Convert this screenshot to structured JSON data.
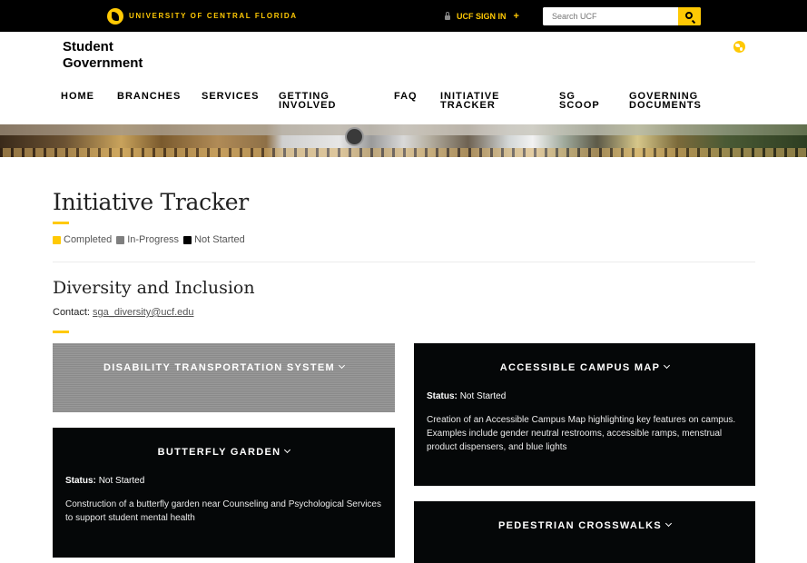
{
  "topbar": {
    "university_name": "UNIVERSITY OF CENTRAL FLORIDA",
    "sign_in_label": "UCF SIGN IN",
    "sign_in_plus": "+",
    "search_placeholder": "Search UCF"
  },
  "header": {
    "site_title_line1": "Student",
    "site_title_line2": "Government"
  },
  "nav": [
    {
      "label": "HOME"
    },
    {
      "label": "BRANCHES"
    },
    {
      "label": "SERVICES"
    },
    {
      "label": "GETTING INVOLVED"
    },
    {
      "label": "FAQ"
    },
    {
      "label": "INITIATIVE TRACKER"
    },
    {
      "label": "SG SCOOP"
    },
    {
      "label": "GOVERNING DOCUMENTS"
    }
  ],
  "page": {
    "title": "Initiative Tracker",
    "legend": [
      {
        "label": "Completed",
        "color": "#ffc904"
      },
      {
        "label": "In-Progress",
        "color": "#7f7f7f"
      },
      {
        "label": "Not Started",
        "color": "#000000"
      }
    ]
  },
  "section": {
    "title": "Diversity and Inclusion",
    "contact_label": "Contact:",
    "contact_email": "sga_diversity@ucf.edu"
  },
  "cards": [
    {
      "title": "DISABILITY TRANSPORTATION SYSTEM",
      "state": "In-Progress"
    },
    {
      "title": "ACCESSIBLE CAMPUS MAP",
      "status_label": "Status:",
      "status_value": "Not Started",
      "description": "Creation of an Accessible Campus Map highlighting key features on campus. Examples include gender neutral restrooms, accessible ramps, menstrual product dispensers, and blue lights"
    },
    {
      "title": "BUTTERFLY GARDEN",
      "status_label": "Status:",
      "status_value": "Not Started",
      "description": "Construction of a butterfly garden near Counseling and Psychological Services to support student mental health"
    },
    {
      "title": "PEDESTRIAN CROSSWALKS",
      "state": "Not Started"
    }
  ],
  "colors": {
    "accent": "#ffc904",
    "card_dark": "#050708",
    "card_grey": "#8f8f8f"
  }
}
